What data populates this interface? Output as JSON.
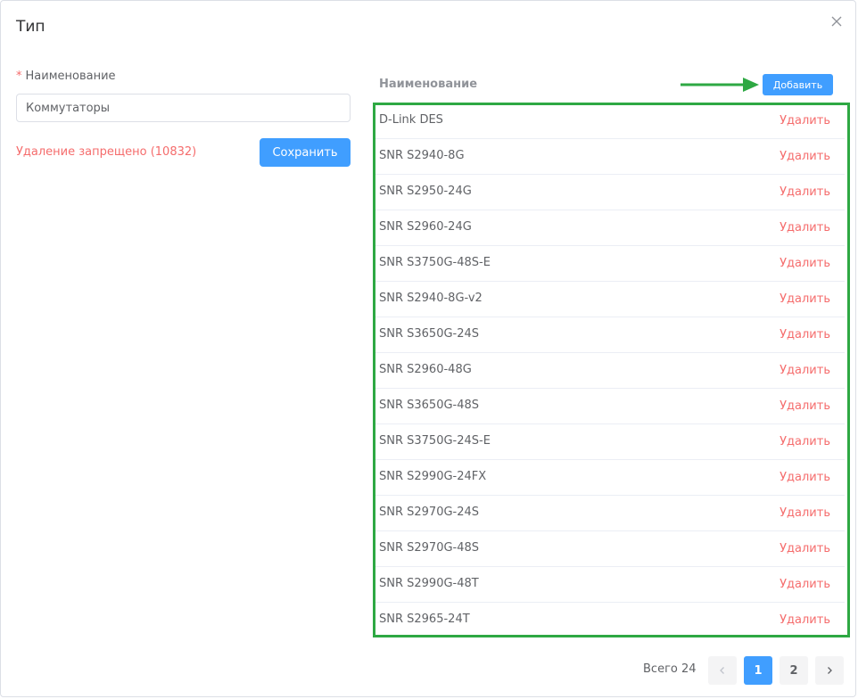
{
  "dialog": {
    "title": "Тип",
    "close_icon": "close-icon"
  },
  "form": {
    "required_mark": "*",
    "name_label": "Наименование",
    "name_value": "Коммутаторы",
    "error_text": "Удаление запрещено (10832)",
    "save_label": "Сохранить"
  },
  "table": {
    "column_header": "Наименование",
    "add_label": "Добавить",
    "rows": [
      {
        "name": "D-Link DES",
        "action": "Удалить"
      },
      {
        "name": "SNR S2940-8G",
        "action": "Удалить"
      },
      {
        "name": "SNR S2950-24G",
        "action": "Удалить"
      },
      {
        "name": "SNR S2960-24G",
        "action": "Удалить"
      },
      {
        "name": "SNR S3750G-48S-E",
        "action": "Удалить"
      },
      {
        "name": "SNR S2940-8G-v2",
        "action": "Удалить"
      },
      {
        "name": "SNR S3650G-24S",
        "action": "Удалить"
      },
      {
        "name": "SNR S2960-48G",
        "action": "Удалить"
      },
      {
        "name": "SNR S3650G-48S",
        "action": "Удалить"
      },
      {
        "name": "SNR S3750G-24S-E",
        "action": "Удалить"
      },
      {
        "name": "SNR S2990G-24FX",
        "action": "Удалить"
      },
      {
        "name": "SNR S2970G-24S",
        "action": "Удалить"
      },
      {
        "name": "SNR S2970G-48S",
        "action": "Удалить"
      },
      {
        "name": "SNR S2990G-48T",
        "action": "Удалить"
      },
      {
        "name": "SNR S2965-24T",
        "action": "Удалить"
      }
    ]
  },
  "pagination": {
    "total": "Всего 24",
    "pages": [
      "1",
      "2"
    ],
    "current": "1"
  },
  "colors": {
    "accent": "#409eff",
    "danger": "#f56c6c",
    "highlight": "#2ea843"
  }
}
